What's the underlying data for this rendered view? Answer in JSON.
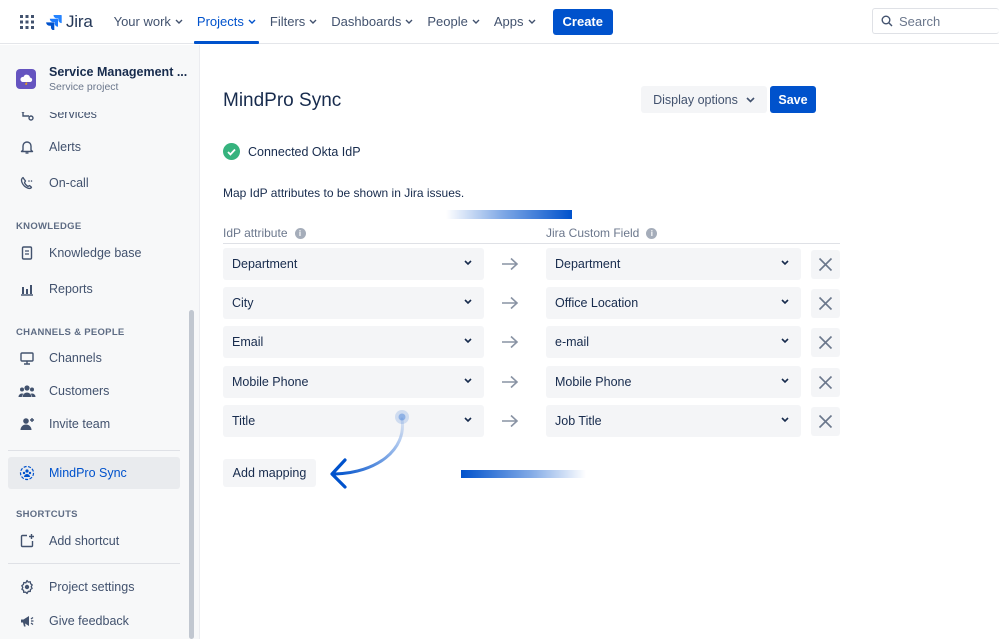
{
  "topnav": {
    "logo": "Jira",
    "items": [
      {
        "label": "Your work",
        "active": false
      },
      {
        "label": "Projects",
        "active": true
      },
      {
        "label": "Filters",
        "active": false
      },
      {
        "label": "Dashboards",
        "active": false
      },
      {
        "label": "People",
        "active": false
      },
      {
        "label": "Apps",
        "active": false
      }
    ],
    "create_label": "Create",
    "search_placeholder": "Search"
  },
  "sidebar": {
    "project_name": "Service Management ...",
    "project_type": "Service project",
    "items": {
      "services": "Services",
      "alerts": "Alerts",
      "oncall": "On-call",
      "knowledge_base": "Knowledge base",
      "reports": "Reports",
      "channels": "Channels",
      "customers": "Customers",
      "invite_team": "Invite team",
      "mindpro_sync": "MindPro Sync",
      "add_shortcut": "Add shortcut",
      "project_settings": "Project settings",
      "give_feedback": "Give feedback"
    },
    "sections": {
      "knowledge": "KNOWLEDGE",
      "channels_people": "CHANNELS & PEOPLE",
      "shortcuts": "SHORTCUTS"
    }
  },
  "main": {
    "title": "MindPro Sync",
    "display_options": "Display options",
    "save": "Save",
    "connected": "Connected Okta IdP",
    "description": "Map IdP attributes to be shown in Jira issues.",
    "col_idp": "IdP attribute",
    "col_jira": "Jira Custom Field",
    "info_glyph": "i",
    "mappings": [
      {
        "idp": "Department",
        "jira": "Department"
      },
      {
        "idp": "City",
        "jira": "Office Location"
      },
      {
        "idp": "Email",
        "jira": "e-mail"
      },
      {
        "idp": "Mobile Phone",
        "jira": "Mobile Phone"
      },
      {
        "idp": "Title",
        "jira": "Job Title"
      }
    ],
    "add_mapping": "Add mapping"
  },
  "colors": {
    "accent": "#0052cc",
    "success": "#36b37e",
    "project_avatar": "#6554c0"
  }
}
